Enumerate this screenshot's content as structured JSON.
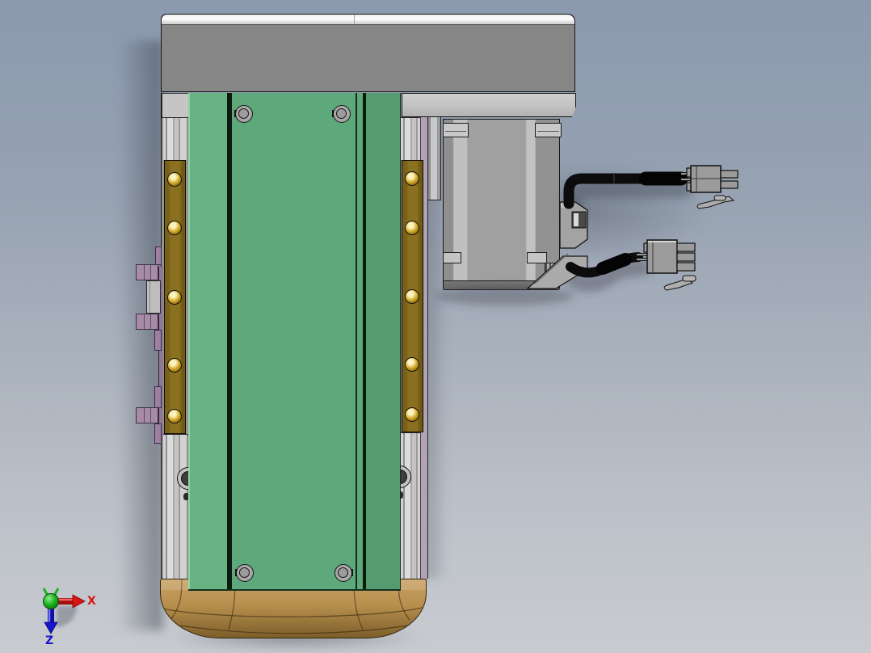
{
  "viewport": {
    "triad": {
      "x_label": "X",
      "z_label": "Z"
    }
  },
  "palette": {
    "bg-top": "#8b9aaf",
    "bg-mid": "#aab2bd",
    "bg-bottom": "#c8cbd0",
    "outline": "#161616",
    "cap-face": "#868686",
    "cap-bevel-light": "#eeeeee",
    "cap-bevel-dark": "#cccccc",
    "plate-face": "#c1c1c1",
    "motor-face": "#a0a0a0",
    "column-flat": "#c5c5c5",
    "green-light": "#67b384",
    "green-main": "#5ea97b",
    "green-dark": "#569a6f",
    "green-edge": "#8fd2a6",
    "brass": "#8a7020",
    "gold-hi": "#fbf3bf",
    "gold-mid": "#d9b237",
    "gold-dark": "#715508",
    "tan-top": "#c9a062",
    "tan-bottom": "#7d5e2a",
    "purple": "#a78ba7",
    "bracket": "#bdbdbd",
    "connector": "#9b9b9b",
    "cable": "#0c0c0c",
    "axis-red": "#d81414",
    "axis-blue": "#1515cf",
    "axis-green": "#18b418"
  }
}
